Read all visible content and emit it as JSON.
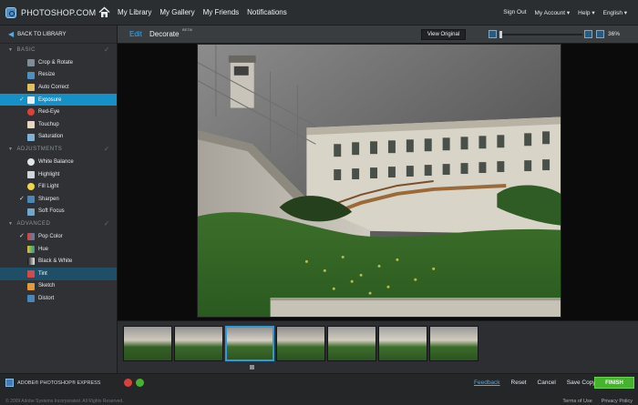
{
  "app": {
    "logo_text": "PHOTOSHOP.COM",
    "nav": [
      "My Library",
      "My Gallery",
      "My Friends",
      "Notifications"
    ],
    "right_nav": [
      "Sign Out",
      "My Account ▾",
      "Help ▾",
      "English ▾"
    ]
  },
  "left": {
    "back": "BACK TO LIBRARY",
    "sections": [
      {
        "title": "BASIC",
        "items": [
          "Crop & Rotate",
          "Resize",
          "Auto Correct",
          "Exposure",
          "Red-Eye",
          "Touchup",
          "Saturation"
        ]
      },
      {
        "title": "ADJUSTMENTS",
        "items": [
          "White Balance",
          "Highlight",
          "Fill Light",
          "Sharpen",
          "Soft Focus"
        ]
      },
      {
        "title": "ADVANCED",
        "items": [
          "Pop Color",
          "Hue",
          "Black & White",
          "Tint",
          "Sketch",
          "Distort"
        ]
      }
    ]
  },
  "toolbar": {
    "tab_edit": "Edit",
    "tab_decorate": "Decorate",
    "beta": "BETA!",
    "view_original": "View Original",
    "zoom": "36%"
  },
  "footer": {
    "brand": "ADOBE® PHOTOSHOP® EXPRESS",
    "feedback": "Feedback",
    "reset": "Reset",
    "cancel": "Cancel",
    "save_copy": "Save Copy",
    "finish": "FINISH",
    "copyright": "© 2009 Adobe Systems Incorporated. All Rights Reserved.",
    "terms": "Terms of Use",
    "privacy": "Privacy Policy"
  },
  "colors": {
    "accent": "#1591c7",
    "finish": "#46b32e",
    "link": "#5aa8df"
  },
  "icons": [
    "home-icon",
    "back-arrow-icon",
    "undo-icon",
    "redo-icon",
    "zoom-out-icon",
    "zoom-in-icon",
    "fit-icon"
  ]
}
